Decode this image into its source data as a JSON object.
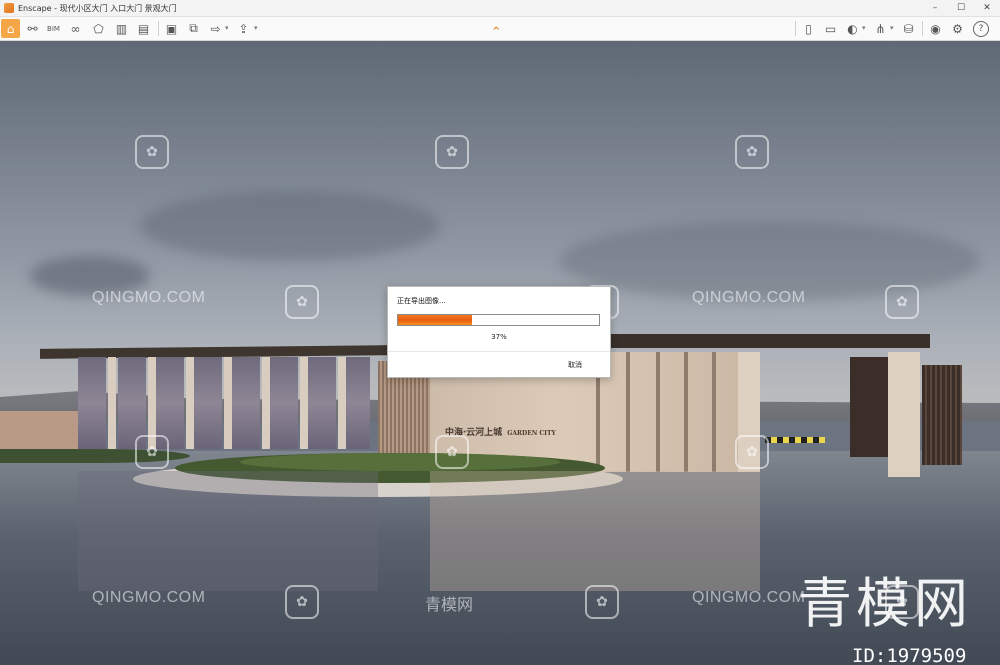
{
  "window": {
    "title": "Enscape - 现代小区大门 入口大门 景观大门",
    "controls": [
      "minimize-icon",
      "maximize-icon",
      "close-icon"
    ]
  },
  "toolbar": {
    "left_icons": [
      "home-icon",
      "link-icon",
      "bim-icon",
      "binoculars-icon",
      "capture-icon",
      "buildings-icon",
      "clapper-icon",
      "screenshot-icon",
      "batch-render-icon",
      "export-icon",
      "upload-icon"
    ],
    "right_icons": [
      "views-icon",
      "panorama-icon",
      "compass-icon",
      "atlas-icon",
      "asset-library-icon",
      "visibility-icon",
      "settings-icon",
      "help-icon"
    ],
    "active": "home-icon"
  },
  "export_dialog": {
    "title": "正在导出图像...",
    "progress": 0.37,
    "progress_label": "37%",
    "cancel_label": "取消"
  },
  "scene": {
    "sign_text": "中海·云河上城",
    "sign_sub": "GARDEN CITY"
  },
  "watermarks": {
    "site": "QINGMO.COM",
    "cn": "青模网",
    "brand": "青模网",
    "id": "ID:1979509"
  },
  "colors": {
    "accent": "#f5a646",
    "progress": "#ea5a10"
  }
}
